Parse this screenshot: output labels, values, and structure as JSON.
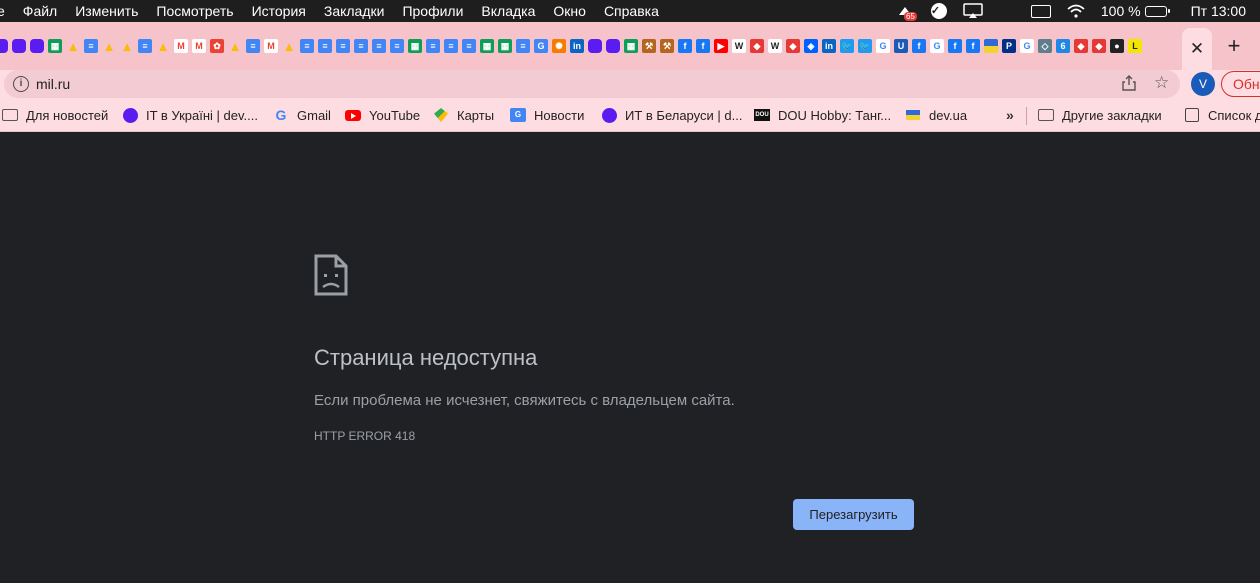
{
  "menubar": {
    "app_fragment": "е",
    "items": [
      "Файл",
      "Изменить",
      "Посмотреть",
      "История",
      "Закладки",
      "Профили",
      "Вкладка",
      "Окно",
      "Справка"
    ],
    "badge_count": "65",
    "battery": "100 %",
    "clock": "Пт 13:00"
  },
  "tabs": {
    "favicons": [
      {
        "icon": "hexagon-purple",
        "color": "#5b1cf2"
      },
      {
        "icon": "hexagon-purple",
        "color": "#5b1cf2"
      },
      {
        "icon": "hexagon-purple",
        "color": "#5b1cf2"
      },
      {
        "icon": "google-sheets",
        "color": "#0f9d58"
      },
      {
        "icon": "google-drive",
        "color": "#fbbc04"
      },
      {
        "icon": "google-docs",
        "color": "#4285f4"
      },
      {
        "icon": "google-drive",
        "color": "#fbbc04"
      },
      {
        "icon": "google-drive",
        "color": "#fbbc04"
      },
      {
        "icon": "google-docs",
        "color": "#4285f4"
      },
      {
        "icon": "google-drive",
        "color": "#fbbc04"
      },
      {
        "icon": "gmail",
        "color": "#ea4335"
      },
      {
        "icon": "gmail",
        "color": "#ea4335"
      },
      {
        "icon": "google-photos",
        "color": "#ea4335"
      },
      {
        "icon": "google-drive",
        "color": "#fbbc04"
      },
      {
        "icon": "google-docs",
        "color": "#4285f4"
      },
      {
        "icon": "gmail",
        "color": "#ea4335"
      },
      {
        "icon": "google-drive",
        "color": "#fbbc04"
      },
      {
        "icon": "google-docs",
        "color": "#4285f4"
      },
      {
        "icon": "google-docs",
        "color": "#4285f4"
      },
      {
        "icon": "google-docs",
        "color": "#4285f4"
      },
      {
        "icon": "google-docs",
        "color": "#4285f4"
      },
      {
        "icon": "google-docs",
        "color": "#4285f4"
      },
      {
        "icon": "google-docs",
        "color": "#4285f4"
      },
      {
        "icon": "google-sheets",
        "color": "#0f9d58"
      },
      {
        "icon": "google-docs",
        "color": "#4285f4"
      },
      {
        "icon": "google-docs",
        "color": "#4285f4"
      },
      {
        "icon": "google-docs",
        "color": "#4285f4"
      },
      {
        "icon": "google-sheets",
        "color": "#0f9d58"
      },
      {
        "icon": "google-sheets",
        "color": "#0f9d58"
      },
      {
        "icon": "google-docs",
        "color": "#4285f4"
      },
      {
        "icon": "google-translate",
        "color": "#4285f4"
      },
      {
        "icon": "settings-orange",
        "color": "#f57c00"
      },
      {
        "icon": "linkedin",
        "color": "#0a66c2"
      },
      {
        "icon": "hexagon-purple",
        "color": "#5b1cf2"
      },
      {
        "icon": "hexagon-purple",
        "color": "#5b1cf2"
      },
      {
        "icon": "google-sheets",
        "color": "#0f9d58"
      },
      {
        "icon": "gavel",
        "color": "#b5651d"
      },
      {
        "icon": "gavel",
        "color": "#b5651d"
      },
      {
        "icon": "facebook",
        "color": "#1877f2"
      },
      {
        "icon": "facebook",
        "color": "#1877f2"
      },
      {
        "icon": "youtube",
        "color": "#ff0000"
      },
      {
        "icon": "wikipedia",
        "color": "#ffffff"
      },
      {
        "icon": "red-shield",
        "color": "#e53935"
      },
      {
        "icon": "wikipedia",
        "color": "#ffffff"
      },
      {
        "icon": "red-shield",
        "color": "#e53935"
      },
      {
        "icon": "dropbox",
        "color": "#0061ff"
      },
      {
        "icon": "linkedin",
        "color": "#0a66c2"
      },
      {
        "icon": "twitter",
        "color": "#1d9bf0"
      },
      {
        "icon": "twitter",
        "color": "#1d9bf0"
      },
      {
        "icon": "google",
        "color": "#ffffff"
      },
      {
        "icon": "blue-u",
        "color": "#1a5ab8"
      },
      {
        "icon": "facebook",
        "color": "#1877f2"
      },
      {
        "icon": "google",
        "color": "#ffffff"
      },
      {
        "icon": "facebook",
        "color": "#1877f2"
      },
      {
        "icon": "facebook",
        "color": "#1877f2"
      },
      {
        "icon": "ukraine-square",
        "color": "#2f6bd6"
      },
      {
        "icon": "paypal",
        "color": "#003087"
      },
      {
        "icon": "google",
        "color": "#ffffff"
      },
      {
        "icon": "shield-grey",
        "color": "#607d8b"
      },
      {
        "icon": "six",
        "color": "#1e88e5"
      },
      {
        "icon": "red-shield",
        "color": "#e53935"
      },
      {
        "icon": "red-shield",
        "color": "#e53935"
      },
      {
        "icon": "black-circle",
        "color": "#222222"
      },
      {
        "icon": "yellow-l",
        "color": "#f3e600"
      }
    ],
    "close_glyph": "✕",
    "new_tab_glyph": "+"
  },
  "toolbar": {
    "url": "mil.ru",
    "profile_initial": "V",
    "update_label": "Обновить"
  },
  "bookmarks": {
    "items": [
      {
        "label": "Для новостей",
        "icon": "folder-icon"
      },
      {
        "label": "IT в Україні | dev....",
        "icon": "purple-dot-icon"
      },
      {
        "label": "Gmail",
        "icon": "google-icon"
      },
      {
        "label": "YouTube",
        "icon": "youtube-icon"
      },
      {
        "label": "Карты",
        "icon": "maps-icon"
      },
      {
        "label": "Новости",
        "icon": "news-icon"
      },
      {
        "label": "ИТ в Беларуси | d...",
        "icon": "purple-dot-icon"
      },
      {
        "label": "DOU Hobby: Танг...",
        "icon": "dou-icon"
      },
      {
        "label": "dev.ua",
        "icon": "ukraine-flag-icon"
      }
    ],
    "more_glyph": "»",
    "other_label": "Другие закладки",
    "reading_list_label": "Список для чтения"
  },
  "error_page": {
    "title": "Страница недоступна",
    "description": "Если проблема не исчезнет, свяжитесь с владельцем сайта.",
    "code": "HTTP ERROR 418",
    "reload_label": "Перезагрузить"
  }
}
